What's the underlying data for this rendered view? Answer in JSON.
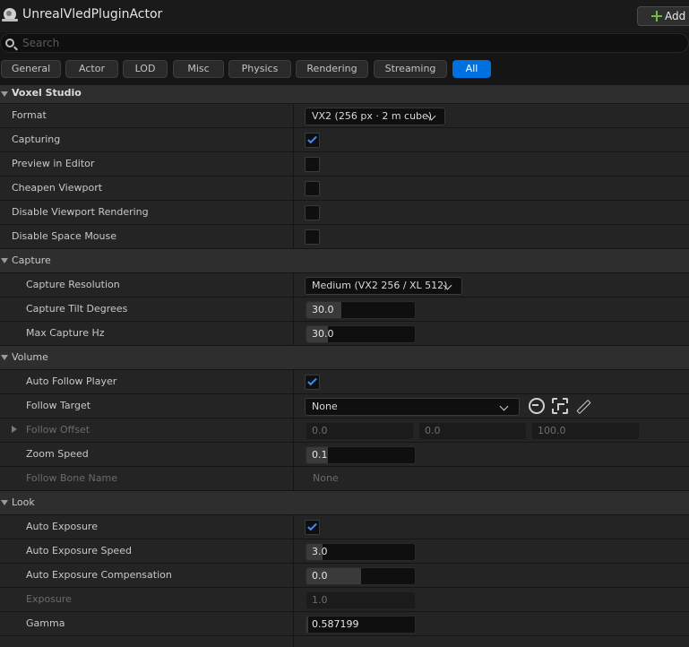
{
  "header": {
    "title": "UnrealVledPluginActor",
    "add_label": "Add"
  },
  "search": {
    "placeholder": "Search",
    "value": ""
  },
  "tabs": [
    "General",
    "Actor",
    "LOD",
    "Misc",
    "Physics",
    "Rendering",
    "Streaming",
    "All"
  ],
  "active_tab": "All",
  "categories": {
    "voxel_studio": "Voxel Studio",
    "capture": "Capture",
    "volume": "Volume",
    "look": "Look"
  },
  "voxel_studio": {
    "format_label": "Format",
    "format_value": "VX2  (256 px · 2 m cube)",
    "capturing_label": "Capturing",
    "capturing": true,
    "preview_label": "Preview in Editor",
    "preview": false,
    "cheapen_label": "Cheapen Viewport",
    "cheapen": false,
    "disable_viewport_label": "Disable Viewport Rendering",
    "disable_viewport": false,
    "disable_mouse_label": "Disable Space Mouse",
    "disable_mouse": false
  },
  "capture": {
    "resolution_label": "Capture Resolution",
    "resolution_value": "Medium  (VX2 256 / XL 512)",
    "tilt_label": "Capture Tilt Degrees",
    "tilt_value": "30.0",
    "tilt_fill": 0.32,
    "hz_label": "Max Capture Hz",
    "hz_value": "30.0",
    "hz_fill": 0.2
  },
  "volume": {
    "auto_follow_label": "Auto Follow Player",
    "auto_follow": true,
    "follow_target_label": "Follow Target",
    "follow_target_value": "None",
    "follow_offset_label": "Follow Offset",
    "follow_offset": [
      "0.0",
      "0.0",
      "100.0"
    ],
    "zoom_label": "Zoom Speed",
    "zoom_value": "0.1",
    "zoom_fill": 0.2,
    "bone_label": "Follow Bone Name",
    "bone_value": "None"
  },
  "look": {
    "auto_exposure_label": "Auto Exposure",
    "auto_exposure": true,
    "speed_label": "Auto Exposure Speed",
    "speed_value": "3.0",
    "speed_fill": 0.15,
    "compensation_label": "Auto Exposure Compensation",
    "compensation_value": "0.0",
    "compensation_fill": 0.5,
    "exposure_label": "Exposure",
    "exposure_value": "1.0",
    "gamma_label": "Gamma",
    "gamma_value": "0.587199",
    "gamma_fill": 0.02
  },
  "colors": {
    "accent": "#0070e0",
    "check": "#3f8cff",
    "add_plus": "#6cbf3b"
  }
}
